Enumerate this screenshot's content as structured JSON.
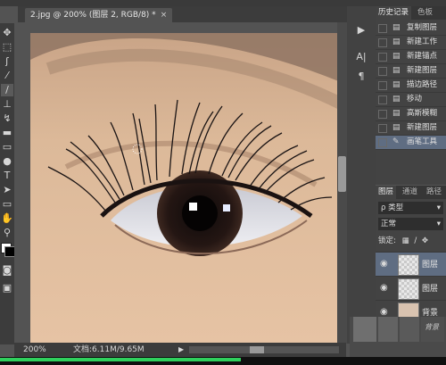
{
  "document": {
    "tab_title": "2.jpg @ 200% (图层 2, RGB/8) *",
    "close_symbol": "×"
  },
  "toolbar": {
    "tools": [
      "move-icon",
      "marquee-icon",
      "lasso-icon",
      "quick-select-icon",
      "crop-icon",
      "eyedropper-icon",
      "healing-icon",
      "brush-icon",
      "clone-stamp-icon",
      "history-brush-icon",
      "eraser-icon",
      "gradient-icon",
      "blur-icon",
      "dodge-icon",
      "pen-icon",
      "type-icon",
      "path-select-icon",
      "shape-icon",
      "hand-icon",
      "zoom-icon"
    ],
    "type_glyph": "T"
  },
  "status": {
    "zoom": "200%",
    "doc_info": "文档:6.11M/9.65M",
    "arrow": "▶"
  },
  "dock": {
    "play_glyph": "▶",
    "char_glyph": "A|",
    "para_glyph": "¶"
  },
  "history": {
    "tabs": [
      "历史记录",
      "色板"
    ],
    "items": [
      {
        "icon": "▤",
        "label": "复制图层",
        "selected": false
      },
      {
        "icon": "▤",
        "label": "新建工作",
        "selected": false
      },
      {
        "icon": "▤",
        "label": "新建锚点",
        "selected": false
      },
      {
        "icon": "▤",
        "label": "新建图层",
        "selected": false
      },
      {
        "icon": "▤",
        "label": "描边路径",
        "selected": false
      },
      {
        "icon": "▤",
        "label": "移动",
        "selected": false
      },
      {
        "icon": "▤",
        "label": "高斯模糊",
        "selected": false
      },
      {
        "icon": "▤",
        "label": "新建图层",
        "selected": false
      },
      {
        "icon": "✎",
        "label": "画笔工具",
        "selected": true
      }
    ]
  },
  "layers": {
    "tabs": [
      "图层",
      "通道",
      "路径"
    ],
    "kind_label": "ρ 类型",
    "blend_mode": "正常",
    "lock_label": "锁定:",
    "items": [
      {
        "name": "图层",
        "selected": true
      },
      {
        "name": "图层",
        "selected": false
      },
      {
        "name": "背景",
        "selected": false
      }
    ],
    "bottom_label": "背景"
  },
  "progress": 0.54
}
